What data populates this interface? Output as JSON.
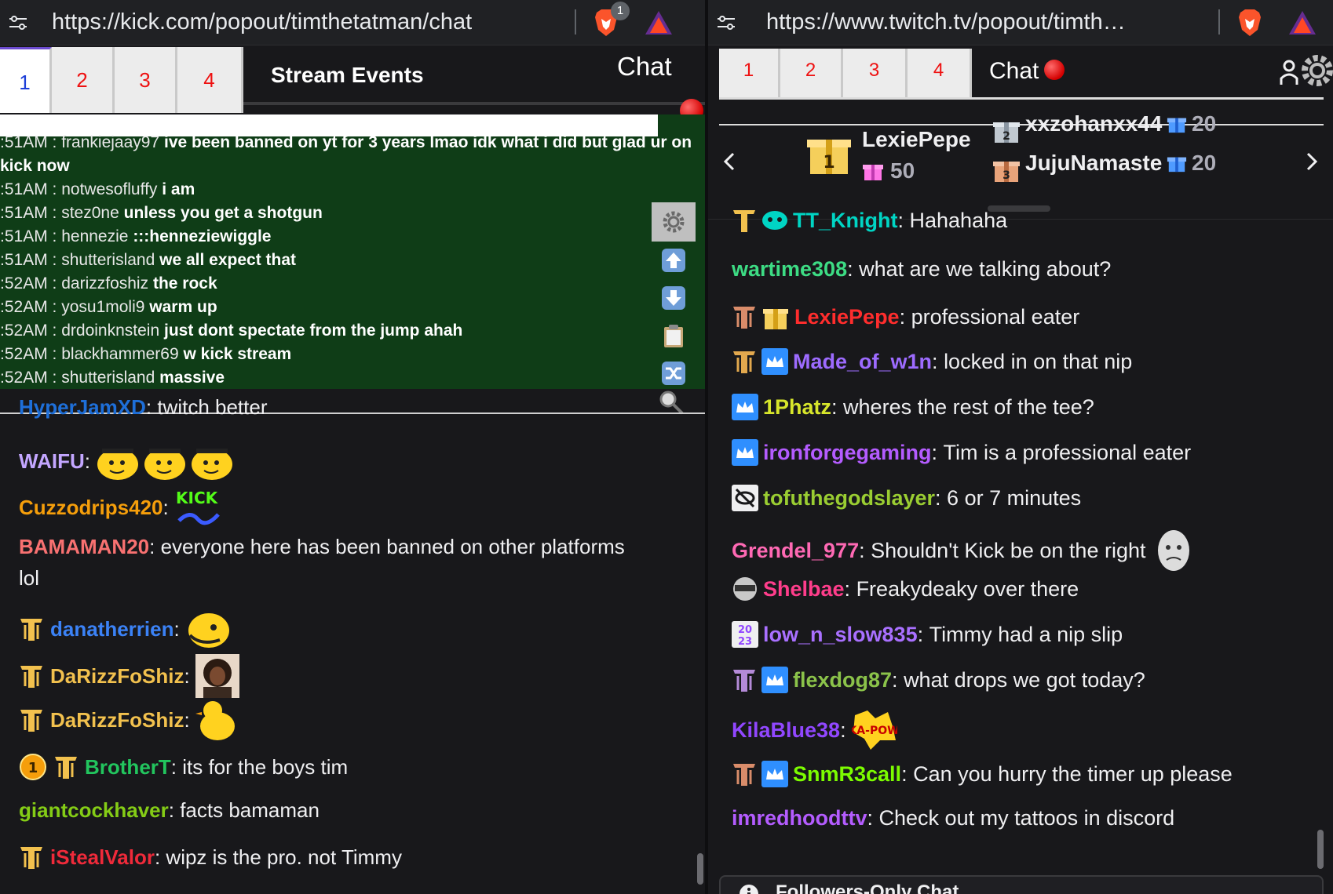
{
  "left": {
    "url": "https://kick.com/popout/timthetatman/chat",
    "brave_badge": "1",
    "tabs": [
      "1",
      "2",
      "3",
      "4"
    ],
    "events_title": "Stream Events",
    "chat_title": "Chat",
    "events": [
      {
        "time": ":51AM",
        "user": "frankiejaay97",
        "text": "ive been banned on yt for 3 years lmao idk what i did but glad ur on"
      },
      {
        "time": "",
        "user": "",
        "text": "kick now"
      },
      {
        "time": ":51AM",
        "user": "notwesofluffy",
        "text": "i am"
      },
      {
        "time": ":51AM",
        "user": "stez0ne",
        "text": "unless you get a shotgun"
      },
      {
        "time": ":51AM",
        "user": "hennezie",
        "text": ":::henneziewiggle"
      },
      {
        "time": ":51AM",
        "user": "shutterisland",
        "text": "we all expect that"
      },
      {
        "time": ":52AM",
        "user": "darizzfoshiz",
        "text": "the rock"
      },
      {
        "time": ":52AM",
        "user": "yosu1moli9",
        "text": "warm up"
      },
      {
        "time": ":52AM",
        "user": "drdoinknstein",
        "text": "just dont spectate from the jump ahah"
      },
      {
        "time": ":52AM",
        "user": "blackhammer69",
        "text": "w kick stream"
      },
      {
        "time": ":52AM",
        "user": "shutterisland",
        "text": "massive"
      }
    ],
    "messages": [
      {
        "user": "HyperJamXD",
        "color": "#1e6fd9",
        "text": "twitch better"
      },
      {
        "user": "WAIFU",
        "color": "#c3a6ff",
        "text": ""
      },
      {
        "user": "Cuzzodrips420",
        "color": "#f59e0b",
        "text": ""
      },
      {
        "user": "BAMAMAN20",
        "color": "#f87171",
        "text": "everyone here has been banned on other platforms"
      },
      {
        "user": "",
        "color": "#efeff1",
        "text": "lol"
      },
      {
        "user": "danatherrien",
        "color": "#3b82f6",
        "text": ""
      },
      {
        "user": "DaRizzFoShiz",
        "color": "#f2c14e",
        "text": ""
      },
      {
        "user": "DaRizzFoShiz",
        "color": "#f2c14e",
        "text": ""
      },
      {
        "user": "BrotherT",
        "color": "#22c55e",
        "text": "its for the boys tim"
      },
      {
        "user": "giantcockhaver",
        "color": "#84cc16",
        "text": "facts bamaman"
      },
      {
        "user": "iStealValor",
        "color": "#ef2a3a",
        "text": "wipz is the pro. not Timmy"
      }
    ],
    "badge_one": "1",
    "kick_emote_text": "KICK"
  },
  "right": {
    "url": "https://www.twitch.tv/popout/timthetat...",
    "tabs": [
      "1",
      "2",
      "3",
      "4"
    ],
    "chat_title": "Chat",
    "leaderboard": {
      "first": {
        "name": "LexiePepe",
        "count": "50",
        "rank": "1"
      },
      "second": {
        "name": "xxzohanxx44",
        "count": "20",
        "rank": "2"
      },
      "third": {
        "name": "JujuNamaste",
        "count": "20",
        "rank": "3"
      }
    },
    "messages": [
      {
        "user": "TT_Knight",
        "color": "#00d5c4",
        "text": "Hahahaha"
      },
      {
        "user": "wartime308",
        "color": "#3ddc84",
        "text": "what are we talking about?"
      },
      {
        "user": "LexiePepe",
        "color": "#ff2d2d",
        "text": "professional eater"
      },
      {
        "user": "Made_of_w1n",
        "color": "#9d6bff",
        "text": "locked in on that nip"
      },
      {
        "user": "1Phatz",
        "color": "#d7e62b",
        "text": "wheres the rest of the tee?"
      },
      {
        "user": "ironforgegaming",
        "color": "#b45cff",
        "text": "Tim is a professional eater"
      },
      {
        "user": "tofuthegodslayer",
        "color": "#9acd32",
        "text": "6 or 7 minutes"
      },
      {
        "user": "Grendel_977",
        "color": "#ff69b4",
        "text": "Shouldn't Kick be on the right"
      },
      {
        "user": "Shelbae",
        "color": "#ff3d8b",
        "text": "Freakydeaky over there"
      },
      {
        "user": "low_n_slow835",
        "color": "#a970ff",
        "text": "Timmy had a nip slip"
      },
      {
        "user": "flexdog87",
        "color": "#8bc34a",
        "text": "what drops we got today?"
      },
      {
        "user": "KilaBlue38",
        "color": "#9147ff",
        "text": ""
      },
      {
        "user": "SnmR3call",
        "color": "#7cfc00",
        "text": "Can you hurry the timer up please"
      },
      {
        "user": "imredhoodttv",
        "color": "#b45cff",
        "text": "Check out my tattoos in discord"
      }
    ],
    "badge_2023": "2023",
    "kapow_text": "KA-POW",
    "followers_only": "Followers-Only Chat"
  }
}
